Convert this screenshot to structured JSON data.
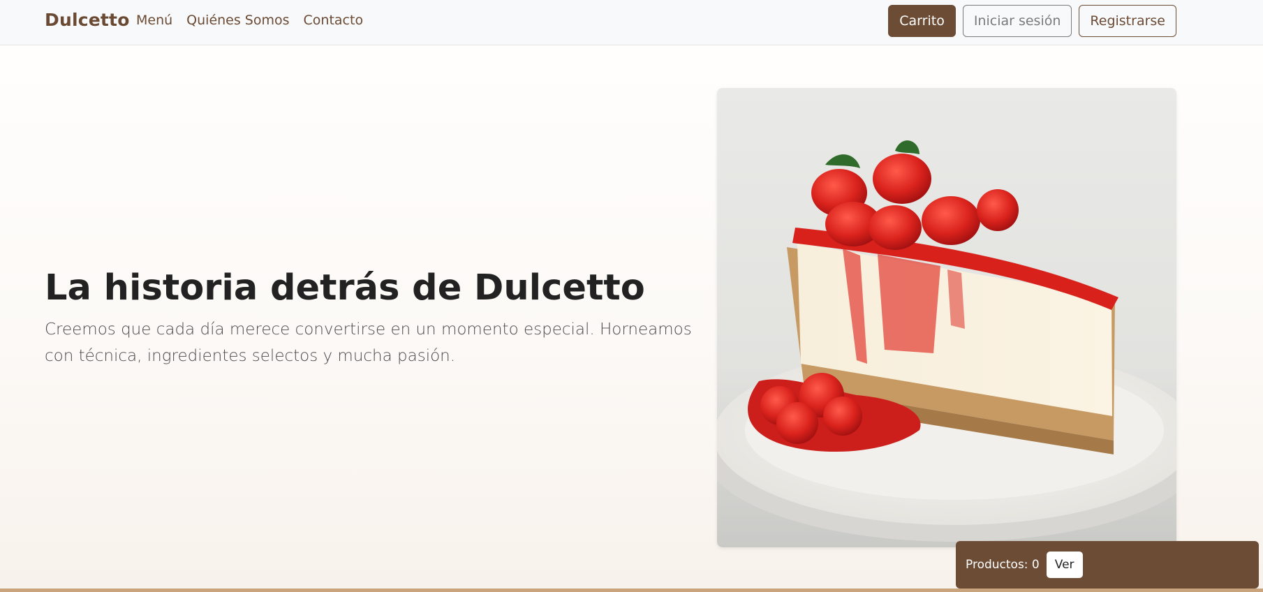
{
  "navbar": {
    "brand": "Dulcetto",
    "links": [
      "Menú",
      "Quiénes Somos",
      "Contacto"
    ],
    "cart_label": "Carrito",
    "login_label": "Iniciar sesión",
    "register_label": "Registrarse"
  },
  "hero": {
    "title": "La historia detrás de Dulcetto",
    "text": "Creemos que cada día merece convertirse en un momento especial. Horneamos con técnica, ingredientes selectos y mucha pasión.",
    "image_icon": "cheesecake-image"
  },
  "cart_widget": {
    "count_text": "Productos: 0",
    "view_label": "Ver"
  },
  "colors": {
    "brand_brown": "#6d4c36",
    "accent_tan": "#c9a47c",
    "navbar_bg": "#f8f9fa"
  }
}
